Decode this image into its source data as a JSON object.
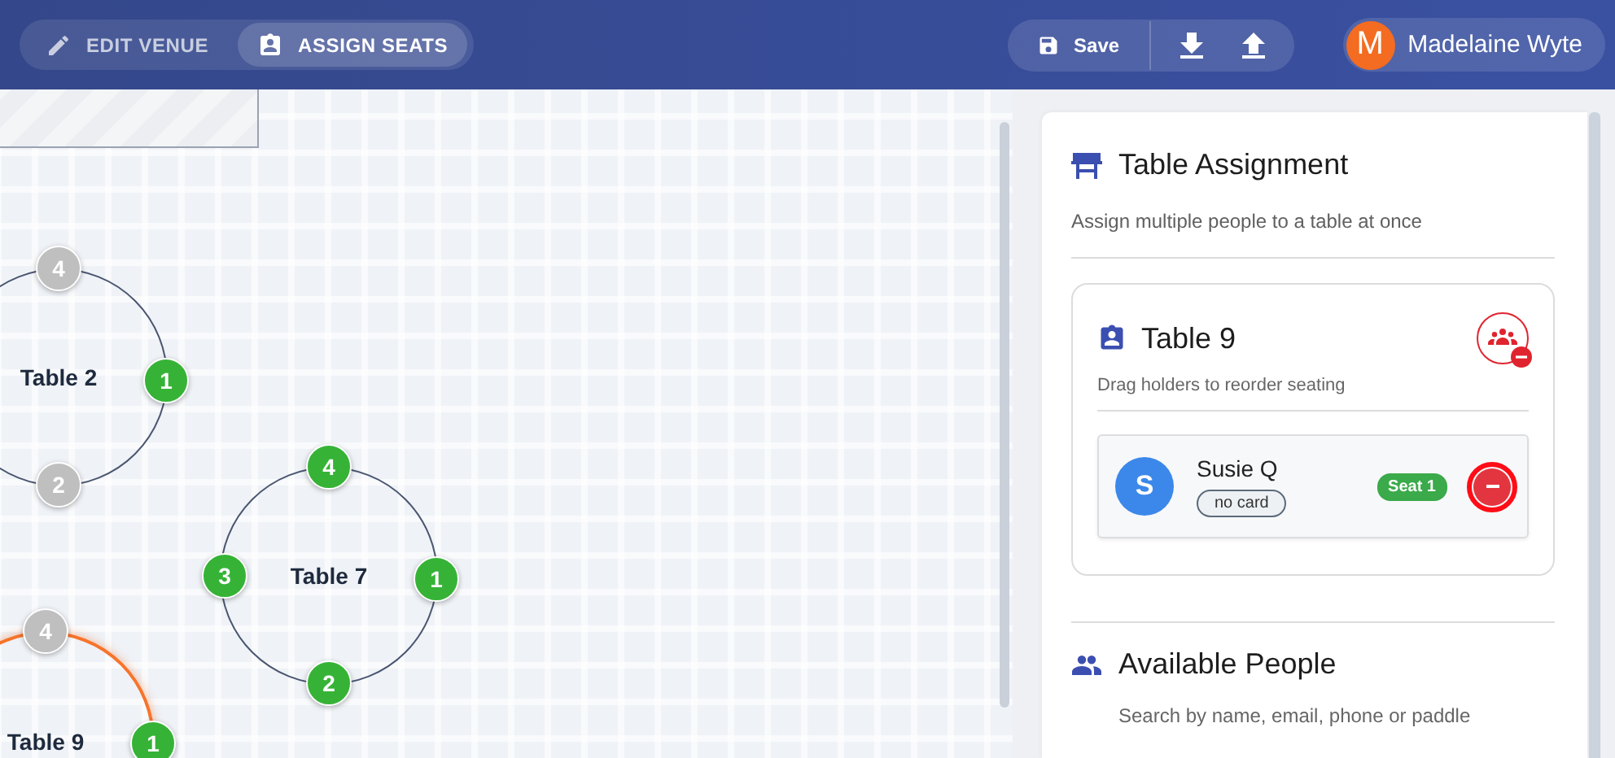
{
  "header": {
    "tabs": [
      {
        "label": "EDIT VENUE",
        "kind": "edit",
        "selected": false
      },
      {
        "label": "ASSIGN SEATS",
        "kind": "assign",
        "selected": true
      }
    ],
    "save_label": "Save",
    "user": {
      "initial": "M",
      "name": "Madelaine Wyte"
    }
  },
  "canvas": {
    "tables": [
      {
        "label": "Table 2",
        "highlighted": false,
        "seats": [
          {
            "number": "4",
            "occupied": false
          },
          {
            "number": "1",
            "occupied": true
          },
          {
            "number": "2",
            "occupied": false
          }
        ]
      },
      {
        "label": "Table 7",
        "highlighted": false,
        "seats": [
          {
            "number": "4",
            "occupied": true
          },
          {
            "number": "3",
            "occupied": true
          },
          {
            "number": "1",
            "occupied": true
          },
          {
            "number": "2",
            "occupied": true
          }
        ]
      },
      {
        "label": "Table 9",
        "highlighted": true,
        "seats": [
          {
            "number": "4",
            "occupied": false
          },
          {
            "number": "1",
            "occupied": true
          }
        ]
      }
    ]
  },
  "panel": {
    "title": "Table Assignment",
    "subtitle": "Assign multiple people to a table at once",
    "group": {
      "title": "Table 9",
      "hint": "Drag holders to reorder seating",
      "holders": [
        {
          "initial": "S",
          "name": "Susie Q",
          "tag": "no card",
          "seat": "Seat 1",
          "focused": true
        }
      ]
    },
    "available": {
      "title": "Available People",
      "hint": "Search by name, email, phone or paddle"
    }
  }
}
